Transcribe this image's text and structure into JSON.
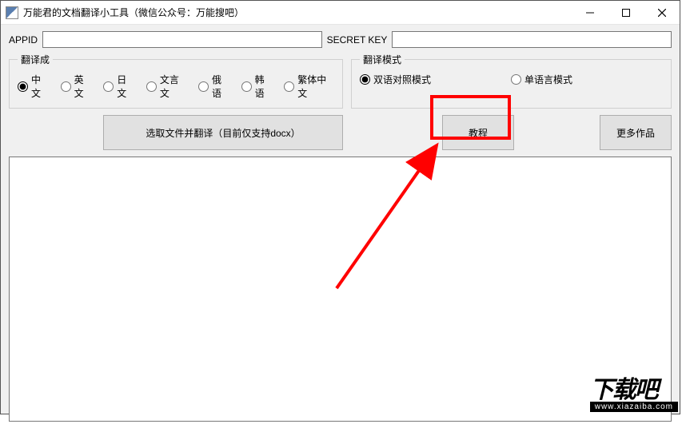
{
  "window": {
    "title": "万能君的文档翻译小工具（微信公众号：万能搜吧）"
  },
  "fields": {
    "appid_label": "APPID",
    "appid_value": "",
    "secret_label": "SECRET KEY",
    "secret_value": ""
  },
  "groups": {
    "translate_to_legend": "翻译成",
    "translate_mode_legend": "翻译模式"
  },
  "languages": {
    "chinese": "中文",
    "english": "英文",
    "japanese": "日文",
    "classical": "文言文",
    "russian": "俄语",
    "korean": "韩语",
    "traditional": "繁体中文"
  },
  "modes": {
    "bilingual": "双语对照模式",
    "mono": "单语言模式"
  },
  "buttons": {
    "select_file": "选取文件并翻译（目前仅支持docx）",
    "tutorial": "教程",
    "more_works": "更多作品"
  },
  "watermark": {
    "main": "下载吧",
    "sub": "www.xiazaiba.com"
  }
}
